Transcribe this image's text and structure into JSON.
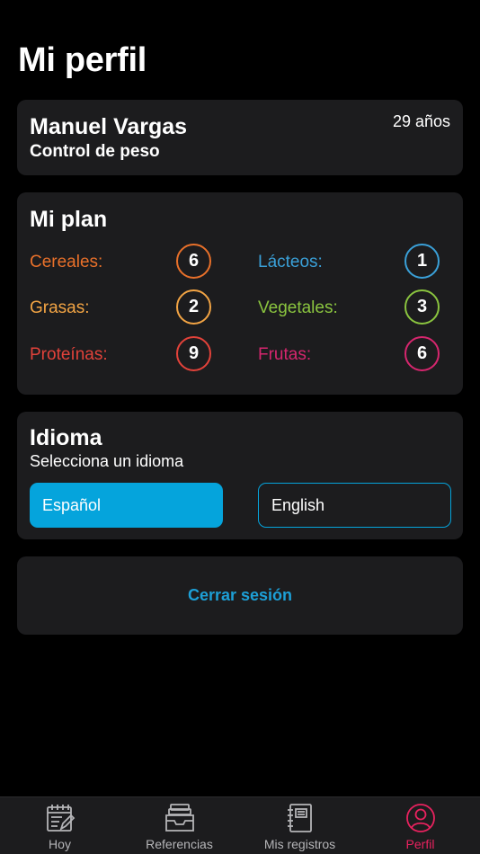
{
  "page": {
    "title": "Mi perfil"
  },
  "profile": {
    "name": "Manuel Vargas",
    "goal": "Control de peso",
    "age": "29 años"
  },
  "plan": {
    "title": "Mi plan",
    "items": [
      {
        "label": "Cereales:",
        "value": "6",
        "color": "#e8702a"
      },
      {
        "label": "Lácteos:",
        "value": "1",
        "color": "#3aa0d8"
      },
      {
        "label": "Grasas:",
        "value": "2",
        "color": "#f2a444"
      },
      {
        "label": "Vegetales:",
        "value": "3",
        "color": "#8ac43f"
      },
      {
        "label": "Proteínas:",
        "value": "9",
        "color": "#e2423a"
      },
      {
        "label": "Frutas:",
        "value": "6",
        "color": "#d6266e"
      }
    ]
  },
  "language": {
    "title": "Idioma",
    "subtitle": "Selecciona un idioma",
    "options": [
      {
        "label": "Español",
        "selected": true
      },
      {
        "label": "English",
        "selected": false
      }
    ],
    "accent": "#05a4dc"
  },
  "logout": {
    "label": "Cerrar sesión"
  },
  "tabbar": {
    "tabs": [
      {
        "label": "Hoy",
        "icon": "calendar-edit-icon",
        "active": false
      },
      {
        "label": "Referencias",
        "icon": "inbox-tray-icon",
        "active": false
      },
      {
        "label": "Mis registros",
        "icon": "notebook-icon",
        "active": false
      },
      {
        "label": "Perfil",
        "icon": "user-profile-icon",
        "active": true
      }
    ],
    "active_color": "#e8225f"
  }
}
